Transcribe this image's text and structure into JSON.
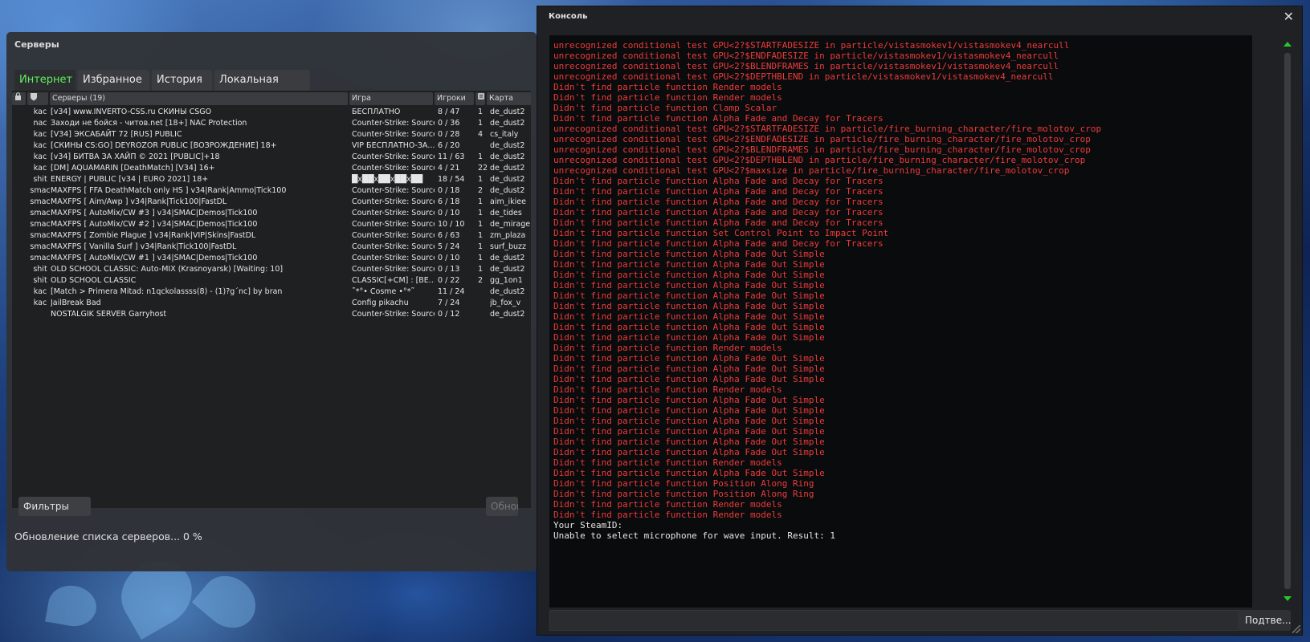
{
  "servers": {
    "title": "Серверы",
    "tabs": [
      "Интернет",
      "Избранное",
      "История",
      "Локальная сеть"
    ],
    "columns": {
      "name": "Серверы (19)",
      "game": "Игра",
      "players": "Игроки",
      "map": "Карта"
    },
    "rows": [
      {
        "tag": "kac",
        "name": "[v34] www.INVERTO-CSS.ru СКИНЫ CSGO",
        "game": "БЕСПЛАТНО",
        "players": "8 / 47",
        "bots": "1",
        "map": "de_dust2"
      },
      {
        "tag": "nac",
        "name": "Заходи не бойся - читов.net [18+] NAC Protection",
        "game": "Counter-Strike: Source",
        "players": "0 / 36",
        "bots": "1",
        "map": "de_dust2"
      },
      {
        "tag": "kac",
        "name": "[V34] ЭКСАБАЙТ 72 [RUS] PUBLIC",
        "game": "Counter-Strike: Source",
        "players": "0 / 28",
        "bots": "4",
        "map": "cs_italy"
      },
      {
        "tag": "kac",
        "name": "[СКИНЫ CS:GO] DEYROZOR PUBLIC [ВОЗРОЖДЕНИЕ] 18+",
        "game": "VIP БЕСПЛАТНО-ЗА...",
        "players": "6 / 20",
        "bots": "",
        "map": "de_dust2"
      },
      {
        "tag": "kac",
        "name": "[v34] БИТВА ЗА ХАЙП © 2021 [PUBLIC]+18",
        "game": "Counter-Strike: Source",
        "players": "11 / 63",
        "bots": "1",
        "map": "de_dust2"
      },
      {
        "tag": "kac",
        "name": "[DM] AQUAMARIN [DeathMatch] [V34] 16+",
        "game": "Counter-Strike: Source",
        "players": "4 / 21",
        "bots": "22",
        "map": "de_dust2"
      },
      {
        "tag": "shit",
        "name": "ENERGY | PUBLIC [v34 | EURO 2021] 18+",
        "game": "█x██x██x██x██",
        "players": "18 / 54",
        "bots": "1",
        "map": "de_dust2"
      },
      {
        "tag": "smac",
        "name": "MAXFPS [ FFA DeathMatch only HS ] v34|Rank|Ammo|Tick100",
        "game": "Counter-Strike: Source",
        "players": "0 / 18",
        "bots": "2",
        "map": "de_dust2"
      },
      {
        "tag": "smac",
        "name": "MAXFPS [ Aim/Awp ] v34|Rank|Tick100|FastDL",
        "game": "Counter-Strike: Source",
        "players": "6 / 18",
        "bots": "1",
        "map": "aim_ikiee"
      },
      {
        "tag": "smac",
        "name": "MAXFPS [ AutoMix/CW #3 ] v34|SMAC|Demos|Tick100",
        "game": "Counter-Strike: Source",
        "players": "0 / 10",
        "bots": "1",
        "map": "de_tides"
      },
      {
        "tag": "smac",
        "name": "MAXFPS [ AutoMix/CW #2 ] v34|SMAC|Demos|Tick100",
        "game": "Counter-Strike: Source",
        "players": "10 / 10",
        "bots": "1",
        "map": "de_mirage"
      },
      {
        "tag": "smac",
        "name": "MAXFPS [ Zombie Plague ] v34|Rank|VIP|Skins|FastDL",
        "game": "Counter-Strike: Source",
        "players": "6 / 63",
        "bots": "1",
        "map": "zm_plaza"
      },
      {
        "tag": "smac",
        "name": "MAXFPS [ Vanilla Surf ] v34|Rank|Tick100|FastDL",
        "game": "Counter-Strike: Source",
        "players": "5 / 24",
        "bots": "1",
        "map": "surf_buzz"
      },
      {
        "tag": "smac",
        "name": "MAXFPS [ AutoMix/CW #1 ] v34|SMAC|Demos|Tick100",
        "game": "Counter-Strike: Source",
        "players": "0 / 10",
        "bots": "1",
        "map": "de_dust2"
      },
      {
        "tag": "shit",
        "name": "OLD SCHOOL CLASSIC: Auto-MIX (Krasnoyarsk) [Waiting: 10]",
        "game": "Counter-Strike: Source",
        "players": "0 / 13",
        "bots": "1",
        "map": "de_dust2"
      },
      {
        "tag": "shit",
        "name": "OLD SCHOOL CLASSIC",
        "game": "CLASSIC[+CM] : [BE...",
        "players": "0 / 22",
        "bots": "2",
        "map": "gg_1on1"
      },
      {
        "tag": "kac",
        "name": "[Match > Primera Mitad: n1qckolassss(8) - (1)?g´nc] by bran",
        "game": "˜*°• Cosme •°*˜",
        "players": "11 / 24",
        "bots": "",
        "map": "de_dust2"
      },
      {
        "tag": "kac",
        "name": "JailBreak Bad",
        "game": "Config pikachu",
        "players": "7 / 24",
        "bots": "",
        "map": "jb_fox_v"
      },
      {
        "tag": "",
        "name": "NOSTALGIK SERVER Garryhost",
        "game": "Counter-Strike: Source",
        "players": "0 / 12",
        "bots": "",
        "map": "de_dust2"
      }
    ],
    "filters_label": "Фильтры",
    "refresh_label": "Обновить",
    "status": "Обновление списка серверов... 0 %"
  },
  "console": {
    "title": "Консоль",
    "submit_label": "Подтве...",
    "input_value": "",
    "lines": [
      {
        "t": "unrecognized conditional test GPU<2?$STARTFADESIZE in particle/vistasmokev1/vistasmokev4_nearcull",
        "c": "red"
      },
      {
        "t": "unrecognized conditional test GPU<2?$ENDFADESIZE in particle/vistasmokev1/vistasmokev4_nearcull",
        "c": "red"
      },
      {
        "t": "unrecognized conditional test GPU<2?$BLENDFRAMES in particle/vistasmokev1/vistasmokev4_nearcull",
        "c": "red"
      },
      {
        "t": "unrecognized conditional test GPU<2?$DEPTHBLEND in particle/vistasmokev1/vistasmokev4_nearcull",
        "c": "red"
      },
      {
        "t": "Didn't find particle function Render models",
        "c": "red"
      },
      {
        "t": "Didn't find particle function Render models",
        "c": "red"
      },
      {
        "t": "Didn't find particle function Clamp Scalar",
        "c": "red"
      },
      {
        "t": "Didn't find particle function Alpha Fade and Decay for Tracers",
        "c": "red"
      },
      {
        "t": "unrecognized conditional test GPU<2?$STARTFADESIZE in particle/fire_burning_character/fire_molotov_crop",
        "c": "red"
      },
      {
        "t": "unrecognized conditional test GPU<2?$ENDFADESIZE in particle/fire_burning_character/fire_molotov_crop",
        "c": "red"
      },
      {
        "t": "unrecognized conditional test GPU<2?$BLENDFRAMES in particle/fire_burning_character/fire_molotov_crop",
        "c": "red"
      },
      {
        "t": "unrecognized conditional test GPU<2?$DEPTHBLEND in particle/fire_burning_character/fire_molotov_crop",
        "c": "red"
      },
      {
        "t": "unrecognized conditional test GPU<2?$maxsize in particle/fire_burning_character/fire_molotov_crop",
        "c": "red"
      },
      {
        "t": "Didn't find particle function Alpha Fade and Decay for Tracers",
        "c": "red"
      },
      {
        "t": "Didn't find particle function Alpha Fade and Decay for Tracers",
        "c": "red"
      },
      {
        "t": "Didn't find particle function Alpha Fade and Decay for Tracers",
        "c": "red"
      },
      {
        "t": "Didn't find particle function Alpha Fade and Decay for Tracers",
        "c": "red"
      },
      {
        "t": "Didn't find particle function Alpha Fade and Decay for Tracers",
        "c": "red"
      },
      {
        "t": "Didn't find particle function Set Control Point to Impact Point",
        "c": "red"
      },
      {
        "t": "Didn't find particle function Alpha Fade and Decay for Tracers",
        "c": "red"
      },
      {
        "t": "Didn't find particle function Alpha Fade Out Simple",
        "c": "red"
      },
      {
        "t": "Didn't find particle function Alpha Fade Out Simple",
        "c": "red"
      },
      {
        "t": "Didn't find particle function Alpha Fade Out Simple",
        "c": "red"
      },
      {
        "t": "Didn't find particle function Alpha Fade Out Simple",
        "c": "red"
      },
      {
        "t": "Didn't find particle function Alpha Fade Out Simple",
        "c": "red"
      },
      {
        "t": "Didn't find particle function Alpha Fade Out Simple",
        "c": "red"
      },
      {
        "t": "Didn't find particle function Alpha Fade Out Simple",
        "c": "red"
      },
      {
        "t": "Didn't find particle function Alpha Fade Out Simple",
        "c": "red"
      },
      {
        "t": "Didn't find particle function Alpha Fade Out Simple",
        "c": "red"
      },
      {
        "t": "Didn't find particle function Render models",
        "c": "red"
      },
      {
        "t": "Didn't find particle function Alpha Fade Out Simple",
        "c": "red"
      },
      {
        "t": "Didn't find particle function Alpha Fade Out Simple",
        "c": "red"
      },
      {
        "t": "Didn't find particle function Alpha Fade Out Simple",
        "c": "red"
      },
      {
        "t": "Didn't find particle function Render models",
        "c": "red"
      },
      {
        "t": "Didn't find particle function Alpha Fade Out Simple",
        "c": "red"
      },
      {
        "t": "Didn't find particle function Alpha Fade Out Simple",
        "c": "red"
      },
      {
        "t": "Didn't find particle function Alpha Fade Out Simple",
        "c": "red"
      },
      {
        "t": "Didn't find particle function Alpha Fade Out Simple",
        "c": "red"
      },
      {
        "t": "Didn't find particle function Alpha Fade Out Simple",
        "c": "red"
      },
      {
        "t": "Didn't find particle function Alpha Fade Out Simple",
        "c": "red"
      },
      {
        "t": "Didn't find particle function Render models",
        "c": "red"
      },
      {
        "t": "Didn't find particle function Alpha Fade Out Simple",
        "c": "red"
      },
      {
        "t": "Didn't find particle function Position Along Ring",
        "c": "red"
      },
      {
        "t": "Didn't find particle function Position Along Ring",
        "c": "red"
      },
      {
        "t": "Didn't find particle function Render models",
        "c": "red"
      },
      {
        "t": "Didn't find particle function Render models",
        "c": "red"
      },
      {
        "t": "Your SteamID:",
        "c": "white",
        "redacted": true
      },
      {
        "t": "Unable to select microphone for wave input. Result: 1",
        "c": "white"
      }
    ]
  }
}
